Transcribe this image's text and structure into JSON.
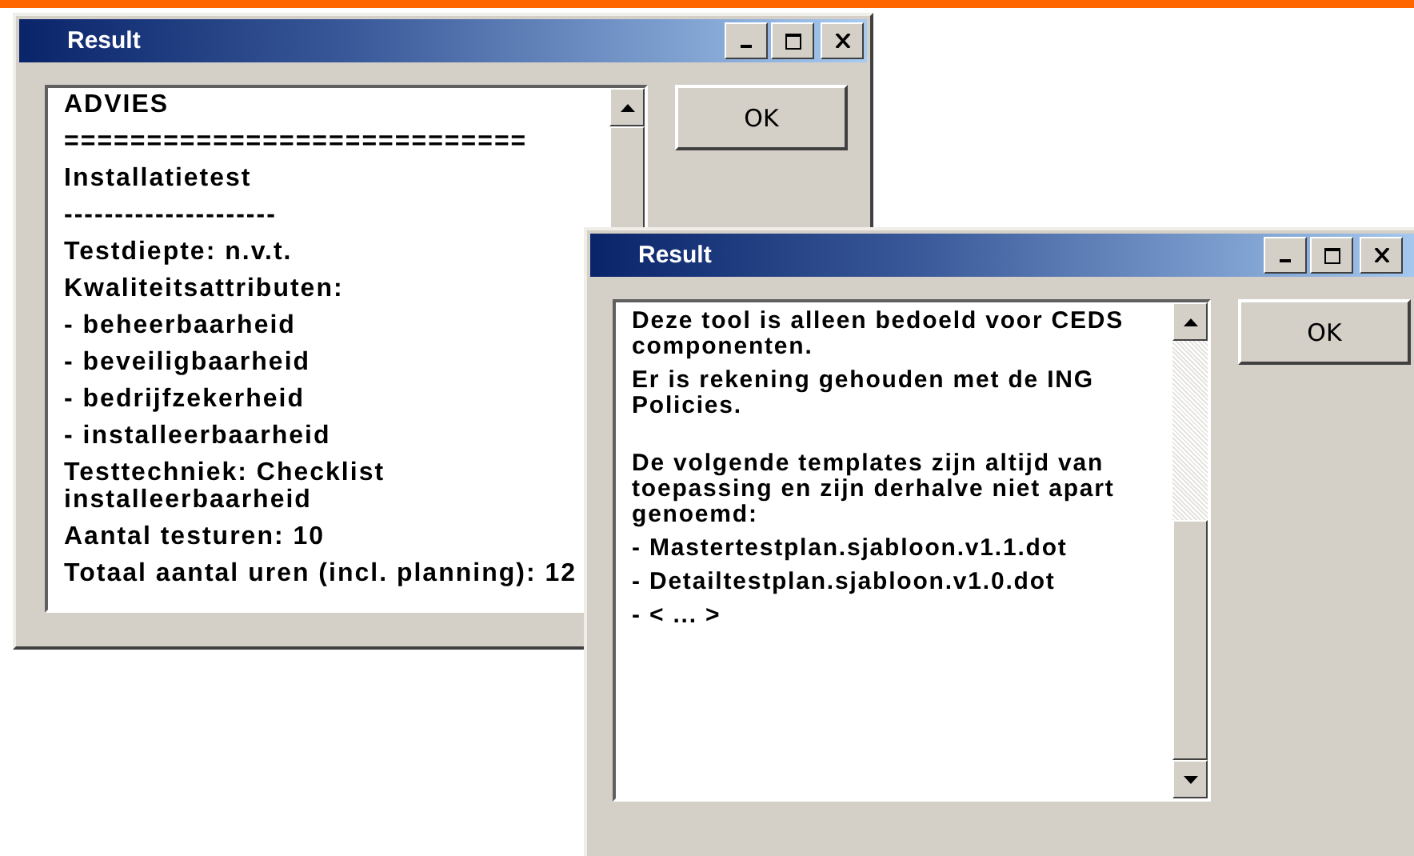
{
  "windows": [
    {
      "title": "Result",
      "button": "OK",
      "blocks": [
        {
          "lines": [
            "ADVIES",
            "============================",
            "Installatietest",
            "---------------------",
            "Testdiepte: n.v.t.",
            "Kwaliteitsattributen:",
            "- beheerbaarheid",
            "- beveiligbaarheid",
            "- bedrijfzekerheid",
            "- installeerbaarheid",
            "Testtechniek: Checklist installeerbaarheid",
            "Aantal testuren: 10",
            "Totaal aantal uren (incl. planning): 12"
          ]
        }
      ]
    },
    {
      "title": "Result",
      "button": "OK",
      "blocks": [
        {
          "lines": [
            "Deze tool is alleen bedoeld voor CEDS componenten.",
            "Er is rekening gehouden met de ING Policies."
          ]
        },
        {
          "lines": [
            "De volgende templates zijn altijd van toepassing en zijn derhalve niet apart genoemd:",
            "- Mastertestplan.sjabloon.v1.1.dot",
            "- Detailtestplan.sjabloon.v1.0.dot",
            "- < ... >"
          ]
        }
      ]
    }
  ]
}
